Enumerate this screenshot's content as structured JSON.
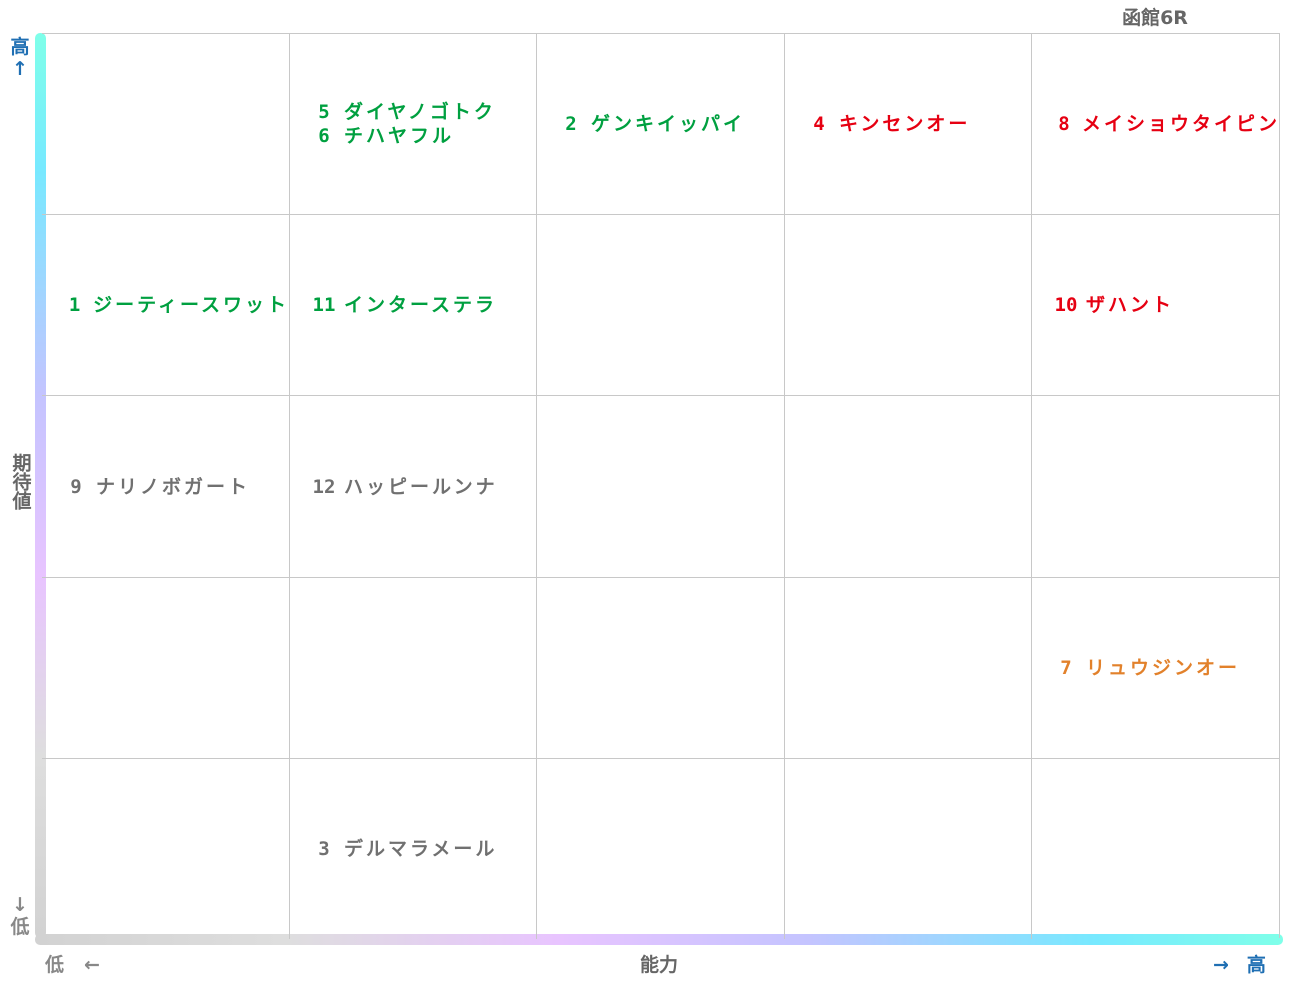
{
  "chart_data": {
    "type": "table",
    "title": "函館6R",
    "xlabel": "能力",
    "ylabel": "期待値",
    "axis_low": "低",
    "axis_high": "高",
    "arrow_left": "←",
    "arrow_right": "→",
    "arrow_up": "↑",
    "arrow_down": "↓",
    "columns": 5,
    "rows": 5,
    "colors": {
      "green": "#00a040",
      "red": "#e60012",
      "orange": "#e2812b",
      "gray": "#707070"
    },
    "entries": [
      {
        "num": "5",
        "name": "ダイヤノゴトク",
        "ability_col": 1,
        "value_row": 0,
        "color": "green"
      },
      {
        "num": "6",
        "name": "チハヤフル",
        "ability_col": 1,
        "value_row": 0,
        "color": "green"
      },
      {
        "num": "2",
        "name": "ゲンキイッパイ",
        "ability_col": 2,
        "value_row": 0,
        "color": "green"
      },
      {
        "num": "4",
        "name": "キンセンオー",
        "ability_col": 3,
        "value_row": 0,
        "color": "red"
      },
      {
        "num": "8",
        "name": "メイショウタイピン",
        "ability_col": 4,
        "value_row": 0,
        "color": "red"
      },
      {
        "num": "1",
        "name": "ジーティースワット",
        "ability_col": 0,
        "value_row": 1,
        "color": "green"
      },
      {
        "num": "11",
        "name": "インターステラ",
        "ability_col": 1,
        "value_row": 1,
        "color": "green"
      },
      {
        "num": "10",
        "name": "ザハント",
        "ability_col": 4,
        "value_row": 1,
        "color": "red"
      },
      {
        "num": "9",
        "name": "ナリノボガート",
        "ability_col": 0,
        "value_row": 2,
        "color": "gray"
      },
      {
        "num": "12",
        "name": "ハッピールンナ",
        "ability_col": 1,
        "value_row": 2,
        "color": "gray"
      },
      {
        "num": "7",
        "name": "リュウジンオー",
        "ability_col": 4,
        "value_row": 3,
        "color": "orange"
      },
      {
        "num": "3",
        "name": "デルマラメール",
        "ability_col": 1,
        "value_row": 4,
        "color": "gray"
      }
    ]
  }
}
